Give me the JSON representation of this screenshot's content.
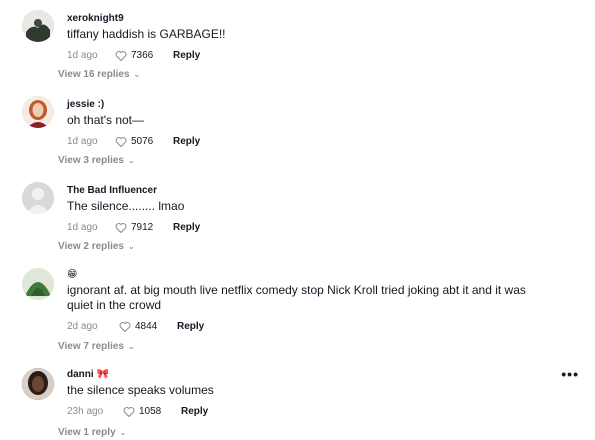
{
  "comments": [
    {
      "username": "xeroknight9",
      "text": "tiffany haddish is GARBAGE!!",
      "date": "1d ago",
      "likes": "7366",
      "reply_label": "Reply",
      "view_replies": "View 16 replies"
    },
    {
      "username": "jessie :)",
      "text": "oh that's not—",
      "date": "1d ago",
      "likes": "5076",
      "reply_label": "Reply",
      "view_replies": "View 3 replies"
    },
    {
      "username": "The Bad Influencer",
      "text": "The silence........ lmao",
      "date": "1d ago",
      "likes": "7912",
      "reply_label": "Reply",
      "view_replies": "View 2 replies"
    },
    {
      "username": "😁",
      "text": "ignorant af. at big mouth live netflix comedy stop Nick Kroll tried joking abt it and it was quiet in the crowd",
      "date": "2d ago",
      "likes": "4844",
      "reply_label": "Reply",
      "view_replies": "View 7 replies"
    },
    {
      "username": "danni 🎀",
      "text": "the silence speaks volumes",
      "date": "23h ago",
      "likes": "1058",
      "reply_label": "Reply",
      "view_replies": "View 1 reply"
    }
  ],
  "more_options": "•••",
  "colors": {
    "text": "#161823",
    "muted": "#8a8b91",
    "avatar_placeholder": "#d9d9d9"
  }
}
